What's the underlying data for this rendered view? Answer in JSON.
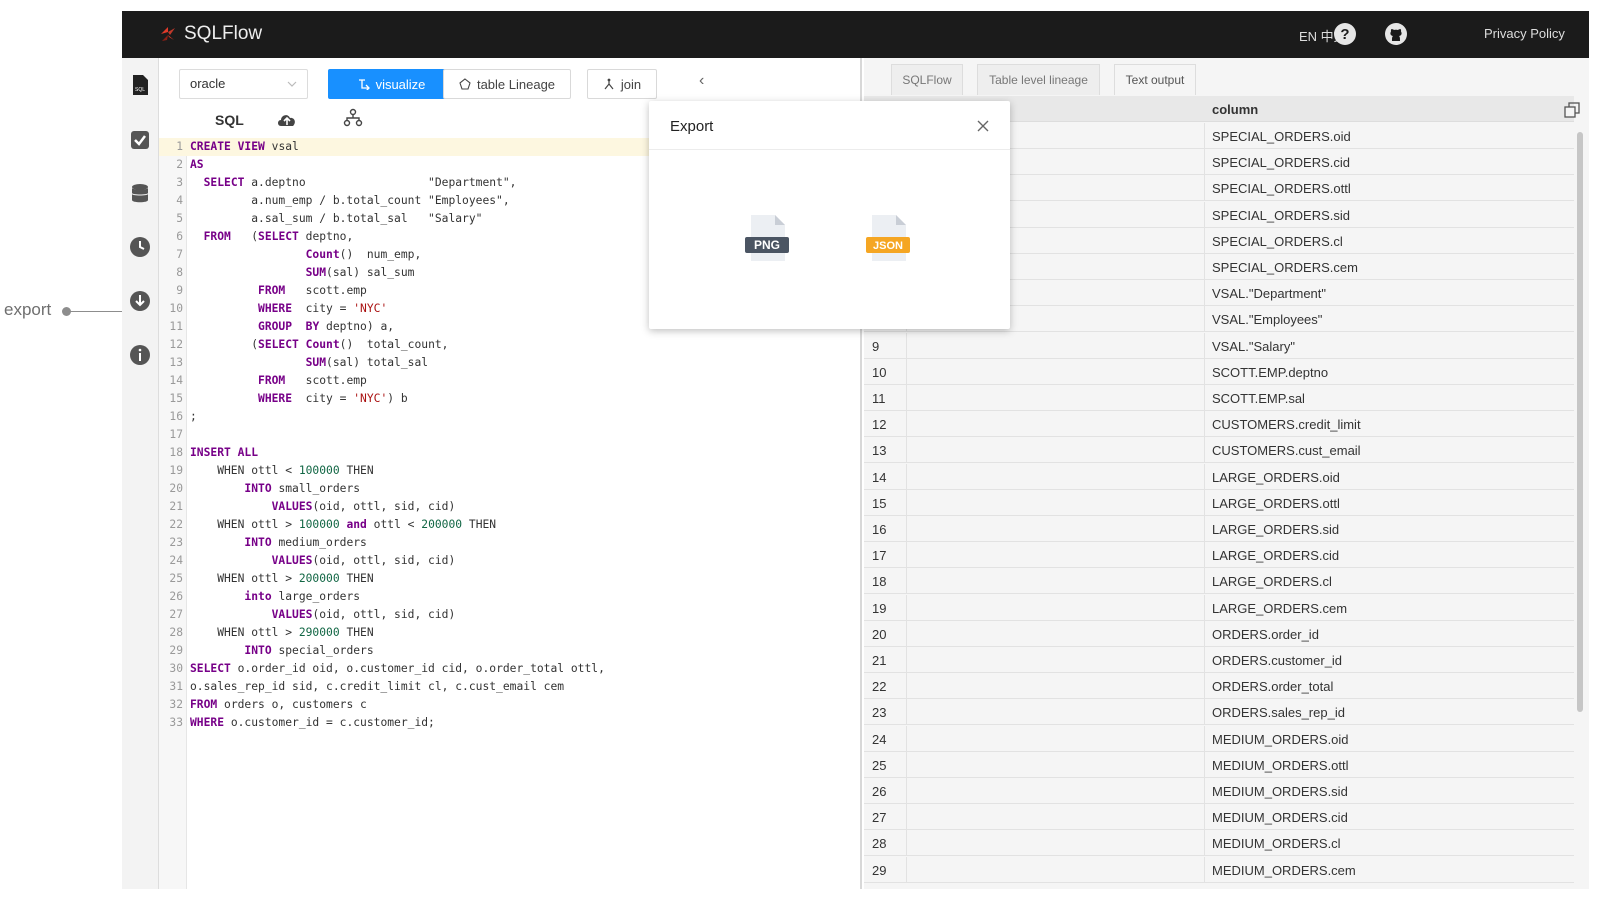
{
  "annotation": {
    "label": "export"
  },
  "topbar": {
    "app_name": "SQLFlow",
    "lang": "EN  中文",
    "privacy": "Privacy Policy"
  },
  "toolbar": {
    "db": "oracle",
    "visualize": "visualize",
    "lineage": "table Lineage",
    "join": "join",
    "collapse": "‹"
  },
  "subtoolbar": {
    "sql": "SQL"
  },
  "code_lines": [
    "CREATE VIEW vsal",
    "AS",
    "  SELECT a.deptno                  \"Department\",",
    "         a.num_emp / b.total_count \"Employees\",",
    "         a.sal_sum / b.total_sal   \"Salary\"",
    "  FROM   (SELECT deptno,",
    "                 Count()  num_emp,",
    "                 SUM(sal) sal_sum",
    "          FROM   scott.emp",
    "          WHERE  city = 'NYC'",
    "          GROUP  BY deptno) a,",
    "         (SELECT Count()  total_count,",
    "                 SUM(sal) total_sal",
    "          FROM   scott.emp",
    "          WHERE  city = 'NYC') b",
    ";",
    "",
    "INSERT ALL",
    "    WHEN ottl < 100000 THEN",
    "        INTO small_orders",
    "            VALUES(oid, ottl, sid, cid)",
    "    WHEN ottl > 100000 and ottl < 200000 THEN",
    "        INTO medium_orders",
    "            VALUES(oid, ottl, sid, cid)",
    "    WHEN ottl > 200000 THEN",
    "        into large_orders",
    "            VALUES(oid, ottl, sid, cid)",
    "    WHEN ottl > 290000 THEN",
    "        INTO special_orders",
    "SELECT o.order_id oid, o.customer_id cid, o.order_total ottl,",
    "o.sales_rep_id sid, c.credit_limit cl, c.cust_email cem",
    "FROM orders o, customers c",
    "WHERE o.customer_id = c.customer_id;"
  ],
  "tabs": [
    "SQLFlow",
    "Table level lineage",
    "Text output"
  ],
  "table": {
    "header": "column",
    "rows": [
      {
        "idx": "",
        "val": "SPECIAL_ORDERS.oid"
      },
      {
        "idx": "",
        "val": "SPECIAL_ORDERS.cid"
      },
      {
        "idx": "",
        "val": "SPECIAL_ORDERS.ottl"
      },
      {
        "idx": "",
        "val": "SPECIAL_ORDERS.sid"
      },
      {
        "idx": "",
        "val": "SPECIAL_ORDERS.cl"
      },
      {
        "idx": "",
        "val": "SPECIAL_ORDERS.cem"
      },
      {
        "idx": "",
        "val": "VSAL.\"Department\""
      },
      {
        "idx": "",
        "val": "VSAL.\"Employees\""
      },
      {
        "idx": "9",
        "val": "VSAL.\"Salary\""
      },
      {
        "idx": "10",
        "val": "SCOTT.EMP.deptno"
      },
      {
        "idx": "11",
        "val": "SCOTT.EMP.sal"
      },
      {
        "idx": "12",
        "val": "CUSTOMERS.credit_limit"
      },
      {
        "idx": "13",
        "val": "CUSTOMERS.cust_email"
      },
      {
        "idx": "14",
        "val": "LARGE_ORDERS.oid"
      },
      {
        "idx": "15",
        "val": "LARGE_ORDERS.ottl"
      },
      {
        "idx": "16",
        "val": "LARGE_ORDERS.sid"
      },
      {
        "idx": "17",
        "val": "LARGE_ORDERS.cid"
      },
      {
        "idx": "18",
        "val": "LARGE_ORDERS.cl"
      },
      {
        "idx": "19",
        "val": "LARGE_ORDERS.cem"
      },
      {
        "idx": "20",
        "val": "ORDERS.order_id"
      },
      {
        "idx": "21",
        "val": "ORDERS.customer_id"
      },
      {
        "idx": "22",
        "val": "ORDERS.order_total"
      },
      {
        "idx": "23",
        "val": "ORDERS.sales_rep_id"
      },
      {
        "idx": "24",
        "val": "MEDIUM_ORDERS.oid"
      },
      {
        "idx": "25",
        "val": "MEDIUM_ORDERS.ottl"
      },
      {
        "idx": "26",
        "val": "MEDIUM_ORDERS.sid"
      },
      {
        "idx": "27",
        "val": "MEDIUM_ORDERS.cid"
      },
      {
        "idx": "28",
        "val": "MEDIUM_ORDERS.cl"
      },
      {
        "idx": "29",
        "val": "MEDIUM_ORDERS.cem"
      }
    ]
  },
  "modal": {
    "title": "Export",
    "png": "PNG",
    "json": "JSON"
  },
  "colors": {
    "topbar": "#1b1b1b",
    "accent": "#1890ff",
    "json_badge": "#f5a623",
    "png_badge": "#4b5563"
  }
}
